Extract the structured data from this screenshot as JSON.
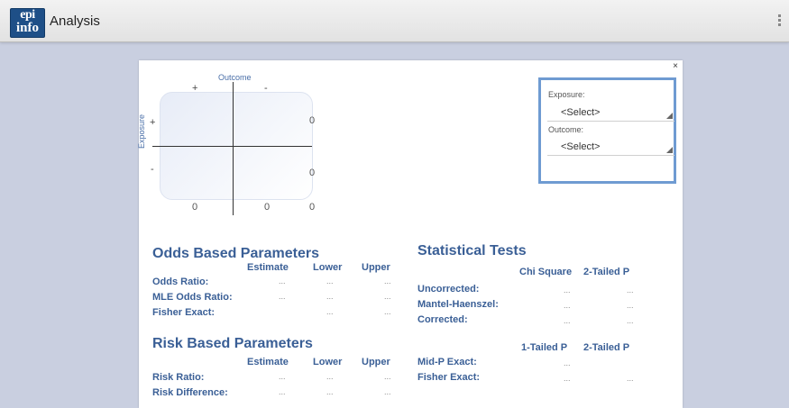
{
  "app": {
    "title": "Analysis",
    "logo_top": "epi",
    "logo_bottom": "info"
  },
  "dialog": {
    "close": "×",
    "table": {
      "outcome_label": "Outcome",
      "exposure_label": "Exposure",
      "plus": "+",
      "minus": "-",
      "counts": {
        "b": "0",
        "d": "0",
        "c_total": "0",
        "col1": "0",
        "col2": "0"
      }
    },
    "selectors": {
      "exposure_label": "Exposure:",
      "exposure_value": "<Select>",
      "outcome_label": "Outcome:",
      "outcome_value": "<Select>"
    },
    "odds": {
      "heading": "Odds Based Parameters",
      "cols": [
        "Estimate",
        "Lower",
        "Upper"
      ],
      "rows": [
        "Odds Ratio:",
        "MLE Odds Ratio:",
        "Fisher Exact:"
      ],
      "dots": "..."
    },
    "risk": {
      "heading": "Risk Based Parameters",
      "cols": [
        "Estimate",
        "Lower",
        "Upper"
      ],
      "rows": [
        "Risk Ratio:",
        "Risk Difference:"
      ]
    },
    "stats": {
      "heading": "Statistical Tests",
      "cols1": [
        "Chi Square",
        "2-Tailed P"
      ],
      "rows1": [
        "Uncorrected:",
        "Mantel-Haenszel:",
        "Corrected:"
      ],
      "cols2": [
        "1-Tailed P",
        "2-Tailed P"
      ],
      "rows2": [
        "Mid-P Exact:",
        "Fisher Exact:"
      ]
    }
  }
}
